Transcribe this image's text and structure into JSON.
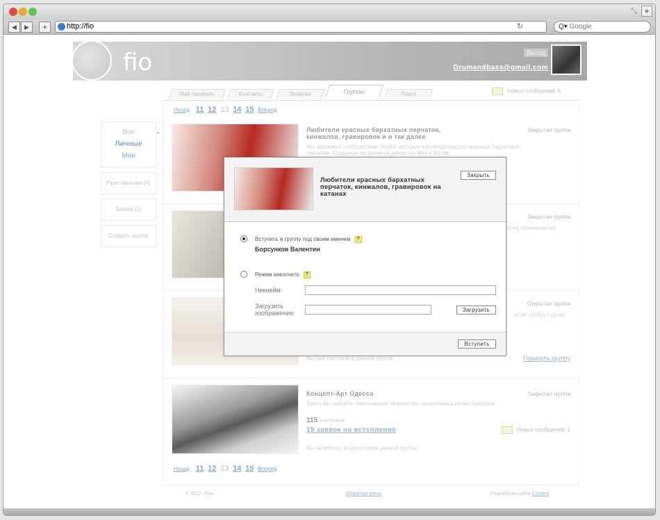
{
  "browser": {
    "url": "http://fio",
    "search_placeholder": "Google",
    "search_prefix": "Q▾"
  },
  "header": {
    "logo": "fio",
    "logout": "Выход",
    "email": "Drumandbass@gmail.com"
  },
  "tabs": [
    "Мой профиль",
    "Контакты",
    "Заметки",
    "Группы",
    "Поиск"
  ],
  "active_tab": "Группы",
  "new_messages_top": "Новых сообщений: 6",
  "pager": {
    "back": "Назад",
    "pages": [
      "11",
      "12",
      "13",
      "14",
      "15"
    ],
    "current": "13",
    "forward": "Вперед"
  },
  "sidebar": {
    "filters": [
      "Все",
      "Личные",
      "Мои"
    ],
    "invitations": "Приглашения (4)",
    "requests": "Заявки (1)",
    "create": "Создать группу"
  },
  "groups": [
    {
      "title": "Любители красных бархатных перчаток, кинжалов, гравировок и и так далее",
      "type": "Закрытая группа",
      "desc": "Мы являемся сообществом людей, которые коллекционируют красные бархатные перчатки. Созданые во времена династии Мин в Китае."
    },
    {
      "type": "Закрытая группа",
      "desc": "группу принимаются"
    },
    {
      "type": "Открытая группа",
      "desc": "ак не пройдут уроки",
      "status": "Вы уже состоите в данной группе",
      "action": "Покинуть группу"
    },
    {
      "title": "Концепт-Арт Одесса",
      "type": "Закрытая группа",
      "desc": "Здесь Вы найдете поклонников творчества талантливых иллюстраторов.",
      "members_count": "115",
      "members_label": "участников",
      "requests_link": "19 заявок на вступление",
      "new_messages": "Новых сообщений: 1",
      "status": "Вы являетесь модератором данной группы"
    }
  ],
  "modal": {
    "title": "Любители красных бархатных перчаток, кинжалов, гравировок на катанах",
    "close": "Закрыть",
    "join_own_name": "Вступить в группу под своим именем",
    "user_name": "Борсунков Валентин",
    "incognito": "Режим инкогнито",
    "nickname_label": "Никнейм:",
    "upload_label": "Загрузить изображение:",
    "upload_button": "Загрузить",
    "join_button": "Вступить",
    "help": "?"
  },
  "footer": {
    "copyright": "© 2012 «Fio»",
    "feedback": "Обратная связь",
    "dev_prefix": "Разработка сайта",
    "dev_link": "Content"
  }
}
